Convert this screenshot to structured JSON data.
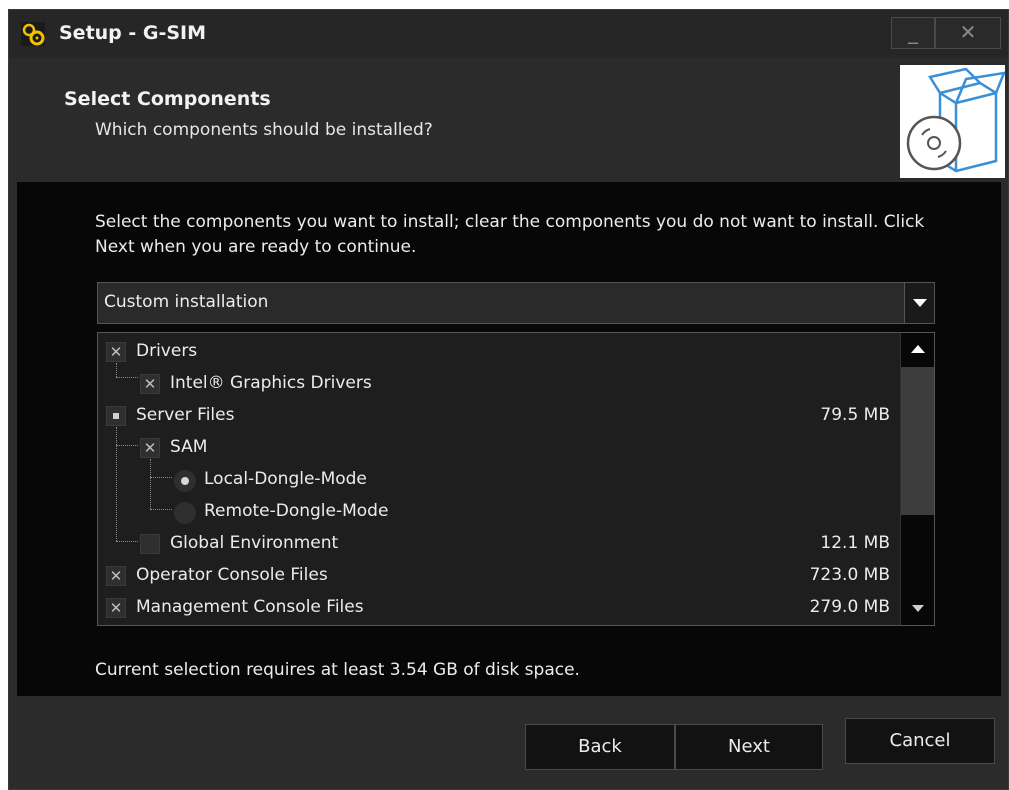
{
  "window": {
    "title": "Setup - G-SIM",
    "minimize_label": "_",
    "close_label": "✕"
  },
  "header": {
    "title": "Select Components",
    "subtitle": "Which components should be installed?"
  },
  "content": {
    "instructions": "Select the components you want to install; clear the components you do not want to install. Click Next when you are ready to continue.",
    "install_type": "Custom installation",
    "disk_space": "Current selection requires at least 3.54 GB of disk space."
  },
  "components": [
    {
      "label": "Drivers",
      "size": "",
      "state": "checked"
    },
    {
      "label": "Intel® Graphics Drivers",
      "size": "",
      "state": "checked"
    },
    {
      "label": "Server Files",
      "size": "79.5 MB",
      "state": "partial"
    },
    {
      "label": "SAM",
      "size": "",
      "state": "checked"
    },
    {
      "label": "Local-Dongle-Mode",
      "size": "",
      "state": "radio-on"
    },
    {
      "label": "Remote-Dongle-Mode",
      "size": "",
      "state": "radio-off"
    },
    {
      "label": "Global Environment",
      "size": "12.1 MB",
      "state": "unchecked"
    },
    {
      "label": "Operator Console Files",
      "size": "723.0 MB",
      "state": "checked"
    },
    {
      "label": "Management Console Files",
      "size": "279.0 MB",
      "state": "checked"
    }
  ],
  "buttons": {
    "back": "Back",
    "next": "Next",
    "cancel": "Cancel"
  },
  "colors": {
    "window_bg": "#2b2b2b",
    "content_bg": "#070707",
    "text": "#ececec",
    "app_icon": "#f2c200"
  }
}
